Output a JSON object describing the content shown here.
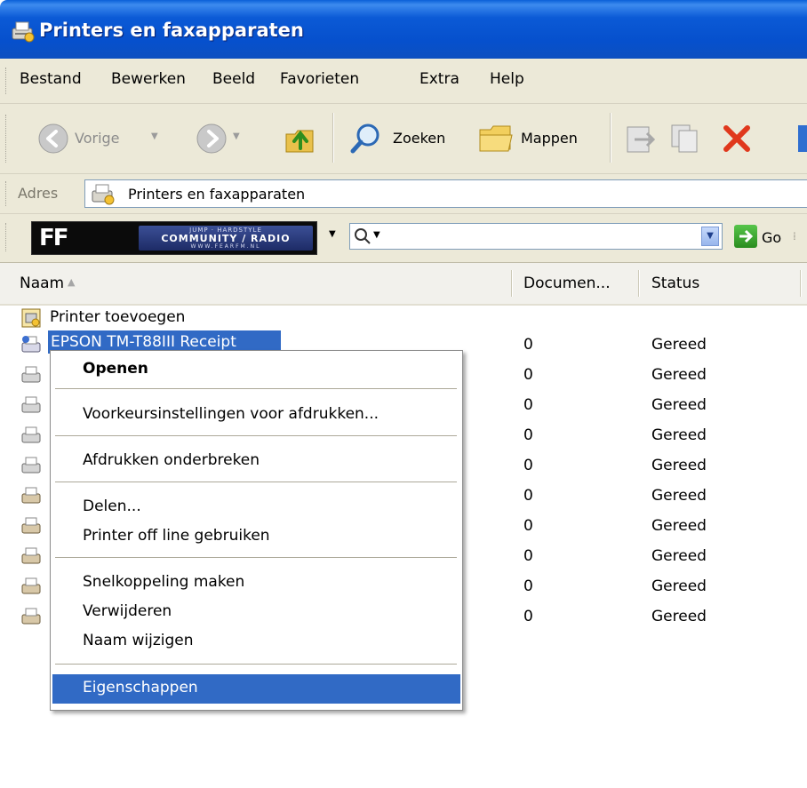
{
  "window": {
    "title": "Printers en faxapparaten"
  },
  "menubar": {
    "items": [
      "Bestand",
      "Bewerken",
      "Beeld",
      "Favorieten",
      "Extra",
      "Help"
    ]
  },
  "toolbar": {
    "back_label": "Vorige",
    "search_label": "Zoeken",
    "folders_label": "Mappen"
  },
  "addressbar": {
    "label": "Adres",
    "value": "Printers en faxapparaten"
  },
  "linksbar": {
    "logo_mark": "FF",
    "logo_line1": "JUMP · HARDSTYLE",
    "logo_line2": "COMMUNITY / RADIO",
    "logo_line3": "WWW.FEARFM.NL",
    "go_label": "Go"
  },
  "columns": {
    "name": "Naam",
    "documents": "Documen...",
    "status": "Status"
  },
  "rows": [
    {
      "name": "Printer toevoegen",
      "docs": "",
      "status": ""
    },
    {
      "name": "EPSON TM-T88III Receipt",
      "docs": "0",
      "status": "Gereed"
    },
    {
      "name": "",
      "docs": "0",
      "status": "Gereed"
    },
    {
      "name": "",
      "docs": "0",
      "status": "Gereed"
    },
    {
      "name": "",
      "docs": "0",
      "status": "Gereed"
    },
    {
      "name": "",
      "docs": "0",
      "status": "Gereed"
    },
    {
      "name": "",
      "docs": "0",
      "status": "Gereed"
    },
    {
      "name": "",
      "docs": "0",
      "status": "Gereed"
    },
    {
      "name": "",
      "docs": "0",
      "status": "Gereed"
    },
    {
      "name": "",
      "docs": "0",
      "status": "Gereed"
    },
    {
      "name": "",
      "docs": "0",
      "status": "Gereed"
    }
  ],
  "context_menu": {
    "open": "Openen",
    "print_prefs": "Voorkeursinstellingen voor afdrukken...",
    "pause_printing": "Afdrukken onderbreken",
    "share": "Delen...",
    "offline": "Printer off line gebruiken",
    "shortcut": "Snelkoppeling maken",
    "delete": "Verwijderen",
    "rename": "Naam wijzigen",
    "properties": "Eigenschappen"
  },
  "colors": {
    "titlebar": "#0b5ad6",
    "selection": "#316ac5",
    "chrome": "#ece9d8"
  },
  "icons": [
    "printers-folder-icon",
    "back-icon",
    "forward-icon",
    "up-folder-icon",
    "search-icon",
    "folders-icon",
    "move-to-icon",
    "copy-to-icon",
    "delete-icon",
    "printer-icon",
    "add-printer-icon",
    "go-icon"
  ]
}
